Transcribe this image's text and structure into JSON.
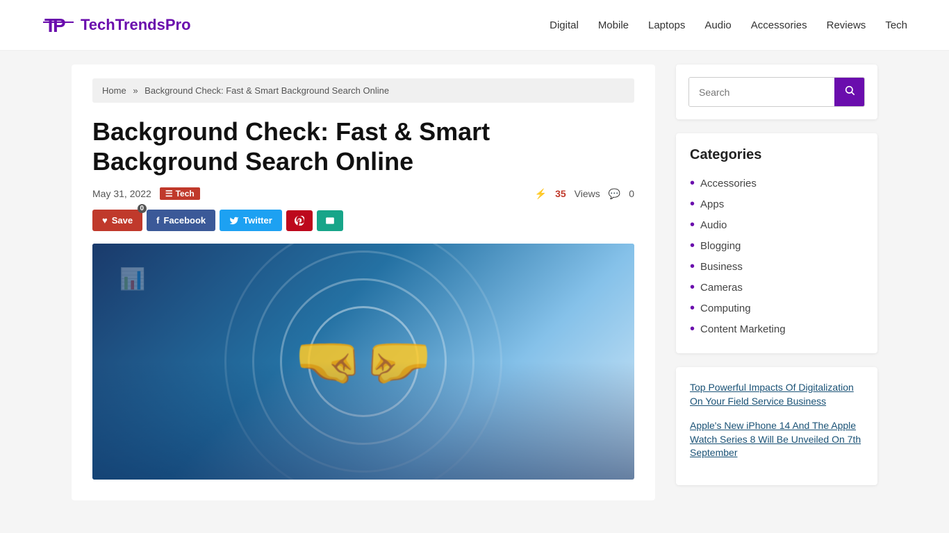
{
  "site": {
    "logo_text": "TechTrendsPro",
    "logo_text_part1": "TechTrends",
    "logo_text_part2": "Pro"
  },
  "nav": {
    "items": [
      {
        "label": "Digital",
        "url": "#"
      },
      {
        "label": "Mobile",
        "url": "#"
      },
      {
        "label": "Laptops",
        "url": "#"
      },
      {
        "label": "Audio",
        "url": "#"
      },
      {
        "label": "Accessories",
        "url": "#"
      },
      {
        "label": "Reviews",
        "url": "#"
      },
      {
        "label": "Tech",
        "url": "#"
      }
    ]
  },
  "breadcrumb": {
    "home_label": "Home",
    "separator": "»",
    "current": "Background Check: Fast & Smart Background Search Online"
  },
  "article": {
    "title": "Background Check: Fast & Smart Background Search Online",
    "date": "May 31, 2022",
    "tag": "Tech",
    "views_count": "35",
    "views_label": "Views",
    "comments_count": "0",
    "lightning": "⚡",
    "comment_icon": "💬"
  },
  "share": {
    "save_label": "Save",
    "save_count": "0",
    "facebook_label": "Facebook",
    "twitter_label": "Twitter",
    "heart_icon": "♥",
    "fb_icon": "f",
    "tw_icon": "t"
  },
  "sidebar": {
    "search": {
      "placeholder": "Search",
      "button_icon": "🔍"
    },
    "categories": {
      "title": "Categories",
      "items": [
        {
          "label": "Accessories"
        },
        {
          "label": "Apps"
        },
        {
          "label": "Audio"
        },
        {
          "label": "Blogging"
        },
        {
          "label": "Business"
        },
        {
          "label": "Cameras"
        },
        {
          "label": "Computing"
        },
        {
          "label": "Content Marketing"
        }
      ]
    },
    "recent_articles": [
      {
        "title": "Top Powerful Impacts Of Digitalization On Your Field Service Business",
        "url": "#"
      },
      {
        "title": "Apple's New iPhone 14 And The Apple Watch Series 8 Will Be Unveiled On 7th September",
        "url": "#"
      }
    ]
  }
}
